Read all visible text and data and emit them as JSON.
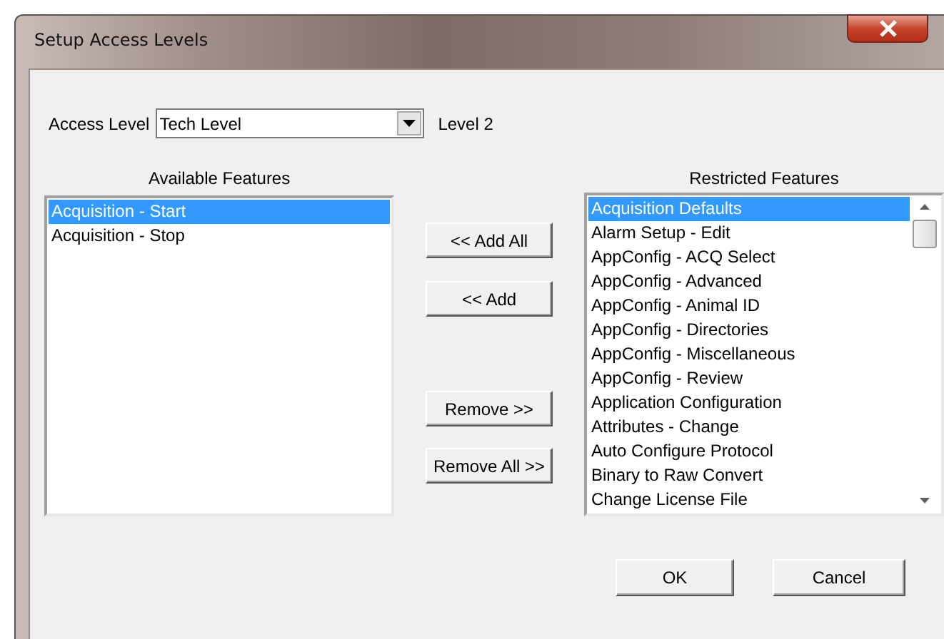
{
  "window": {
    "title": "Setup Access Levels"
  },
  "access_level": {
    "label": "Access Level",
    "value": "Tech Level",
    "level_text": "Level 2"
  },
  "available": {
    "heading": "Available Features",
    "items": [
      {
        "label": "Acquisition - Start",
        "selected": true
      },
      {
        "label": "Acquisition - Stop",
        "selected": false
      }
    ]
  },
  "transfer_buttons": [
    "<< Add All",
    "<< Add",
    "Remove >>",
    "Remove All >>"
  ],
  "restricted": {
    "heading": "Restricted Features",
    "items": [
      {
        "label": "Acquisition Defaults",
        "selected": true
      },
      {
        "label": "Alarm Setup - Edit",
        "selected": false
      },
      {
        "label": "AppConfig - ACQ Select",
        "selected": false
      },
      {
        "label": "AppConfig - Advanced",
        "selected": false
      },
      {
        "label": "AppConfig - Animal ID",
        "selected": false
      },
      {
        "label": "AppConfig - Directories",
        "selected": false
      },
      {
        "label": "AppConfig - Miscellaneous",
        "selected": false
      },
      {
        "label": "AppConfig - Review",
        "selected": false
      },
      {
        "label": "Application Configuration",
        "selected": false
      },
      {
        "label": "Attributes - Change",
        "selected": false
      },
      {
        "label": "Auto Configure Protocol",
        "selected": false
      },
      {
        "label": "Binary to Raw Convert",
        "selected": false
      },
      {
        "label": "Change License File",
        "selected": false
      }
    ]
  },
  "dialog_buttons": [
    "OK",
    "Cancel"
  ]
}
